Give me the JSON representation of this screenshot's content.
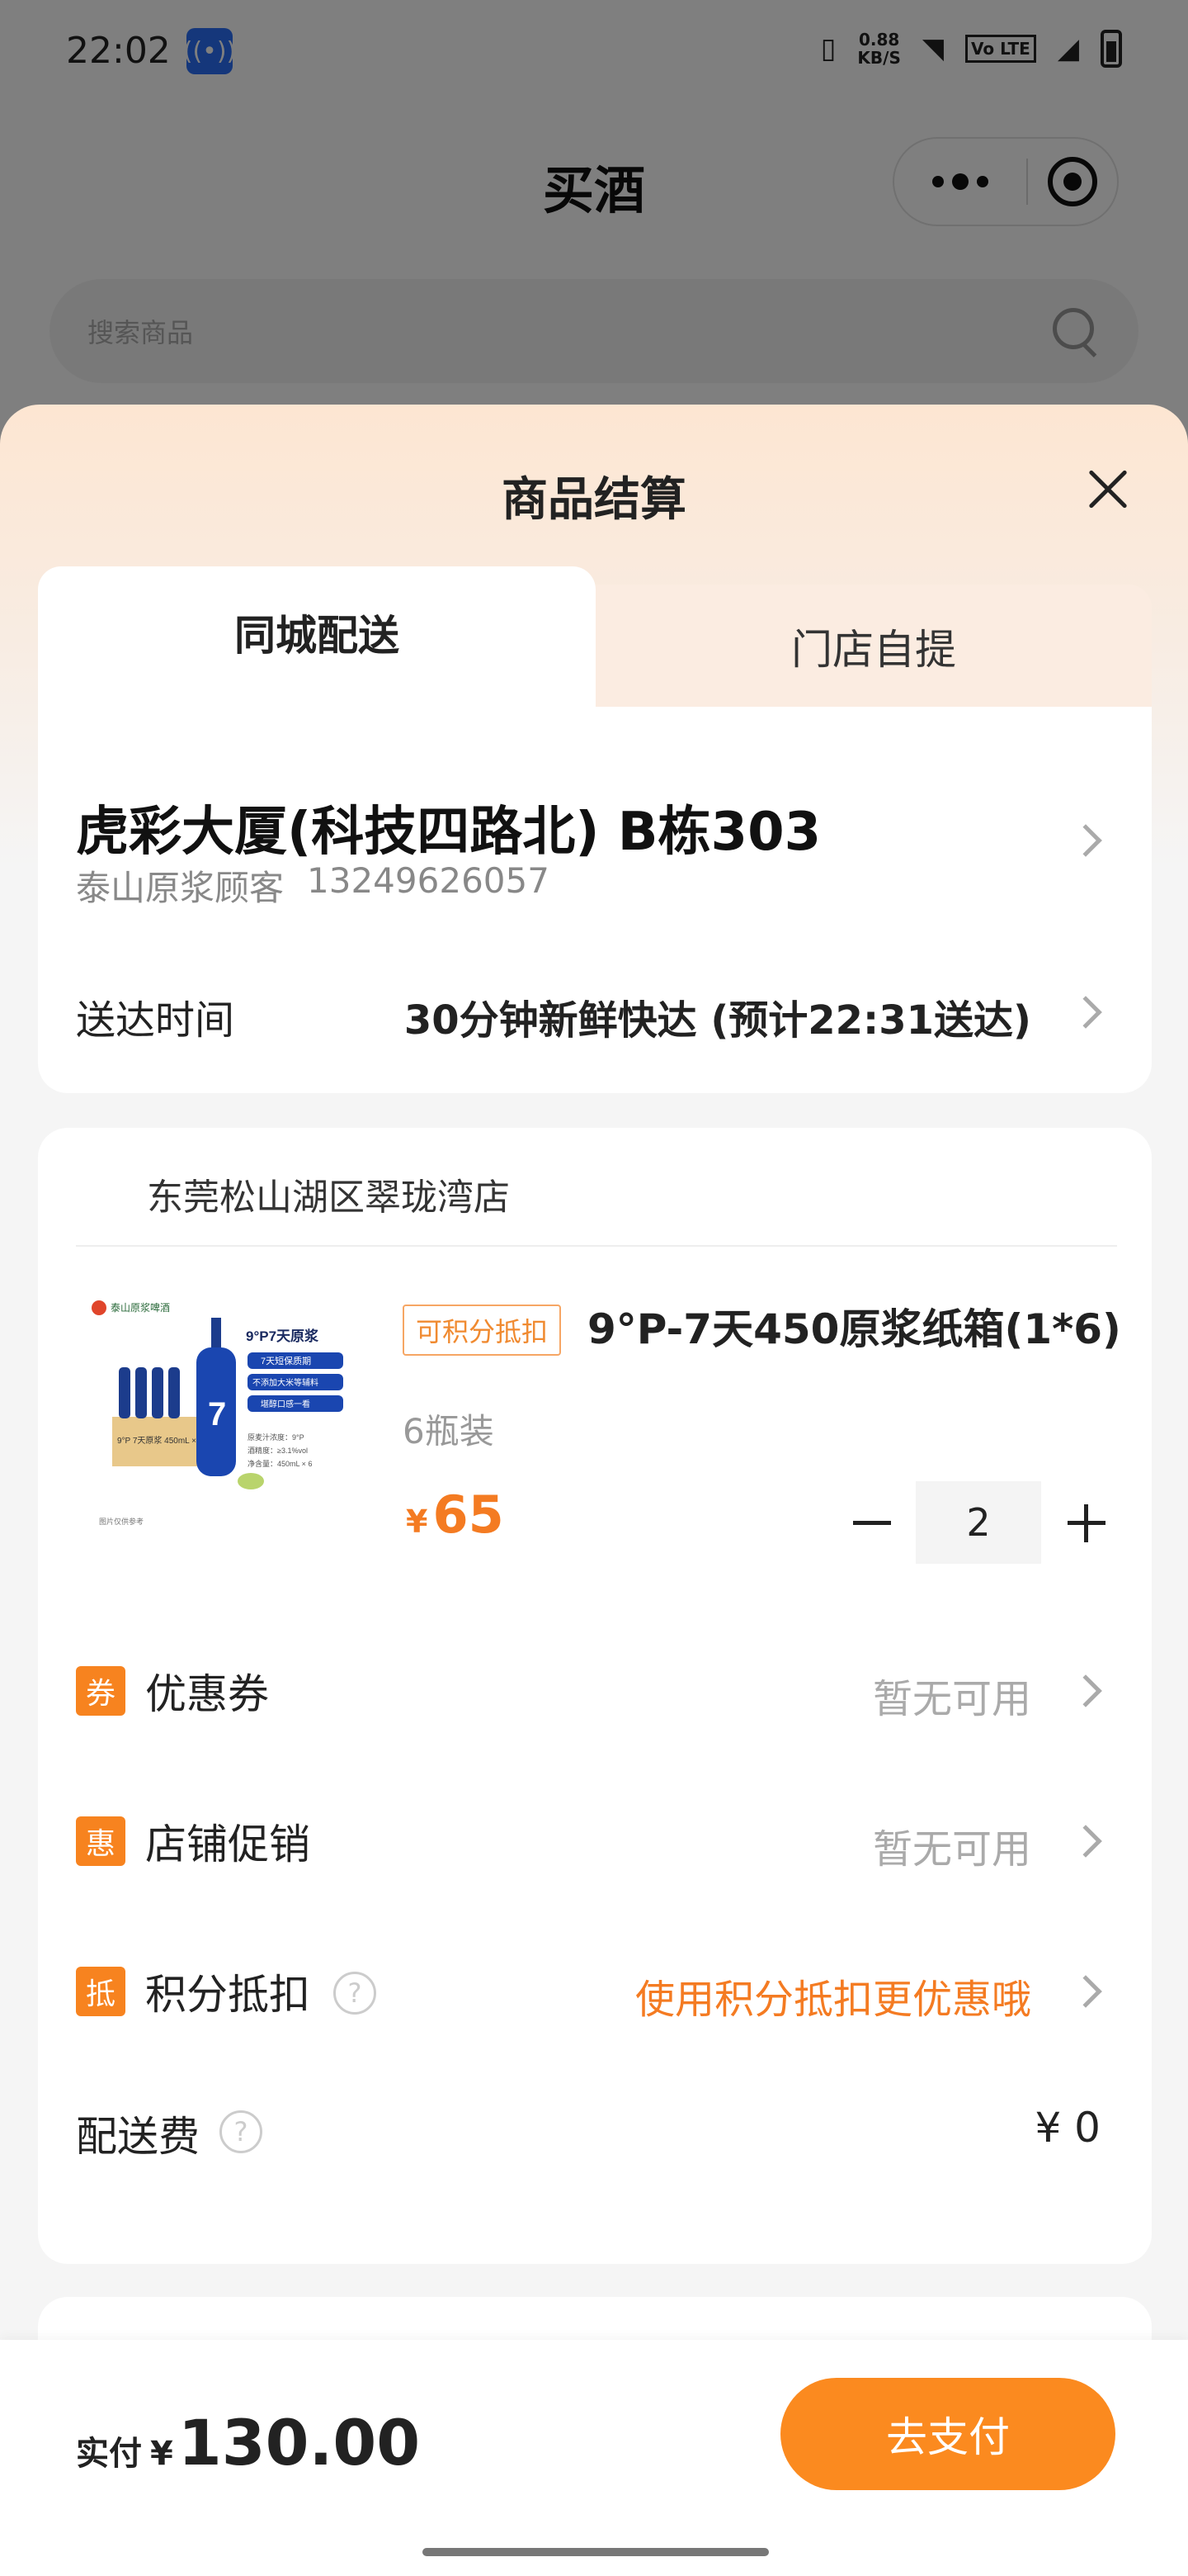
{
  "status_bar": {
    "time": "22:02",
    "speed_value": "0.88",
    "speed_unit": "KB/S",
    "volte": "Vo LTE"
  },
  "page": {
    "title": "买酒",
    "search_placeholder": "搜索商品"
  },
  "sheet": {
    "title": "商品结算",
    "tabs": [
      {
        "label": "同城配送",
        "active": true
      },
      {
        "label": "门店自提",
        "active": false
      }
    ],
    "address": {
      "line": "虎彩大厦(科技四路北) B栋303",
      "contact_name": "泰山原浆顾客",
      "contact_phone": "13249626057"
    },
    "delivery": {
      "label": "送达时间",
      "value": "30分钟新鲜快达 (预计22:31送达)"
    },
    "store": {
      "name": "东莞松山湖区翠珑湾店"
    },
    "product": {
      "badge": "可积分抵扣",
      "name": "9°P-7天450原浆纸箱(1*6)",
      "spec": "6瓶装",
      "currency": "¥",
      "price": "65",
      "quantity": "2",
      "image_text": {
        "brand": "泰山原浆啤酒",
        "headline": "9°P7天原浆",
        "tag1": "7天短保质期",
        "tag2": "不添加大米等辅料",
        "tag3": "堪醇口感一看",
        "box_label": "9°P 7天原浆 450mL × 6瓶",
        "bottle_mark": "7",
        "spec1": "原麦汁浓度：9°P",
        "spec2": "酒精度：≥3.1%vol",
        "spec3": "净含量：450mL × 6",
        "footer": "图片仅供参考"
      }
    },
    "rows": [
      {
        "icon_char": "券",
        "label": "优惠券",
        "value": "暂无可用"
      },
      {
        "icon_char": "惠",
        "label": "店铺促销",
        "value": "暂无可用"
      },
      {
        "icon_char": "抵",
        "label": "积分抵扣",
        "help": "?",
        "value": "使用积分抵扣更优惠哦"
      }
    ],
    "fee": {
      "label": "配送费",
      "help": "?",
      "value": "¥ 0"
    }
  },
  "bottom": {
    "total_label": "实付",
    "currency": "¥",
    "amount": "130.00",
    "pay_label": "去支付"
  },
  "colors": {
    "accent": "#fb8a1f",
    "price": "#f47b22",
    "hotspot": "#2b6ff7"
  }
}
